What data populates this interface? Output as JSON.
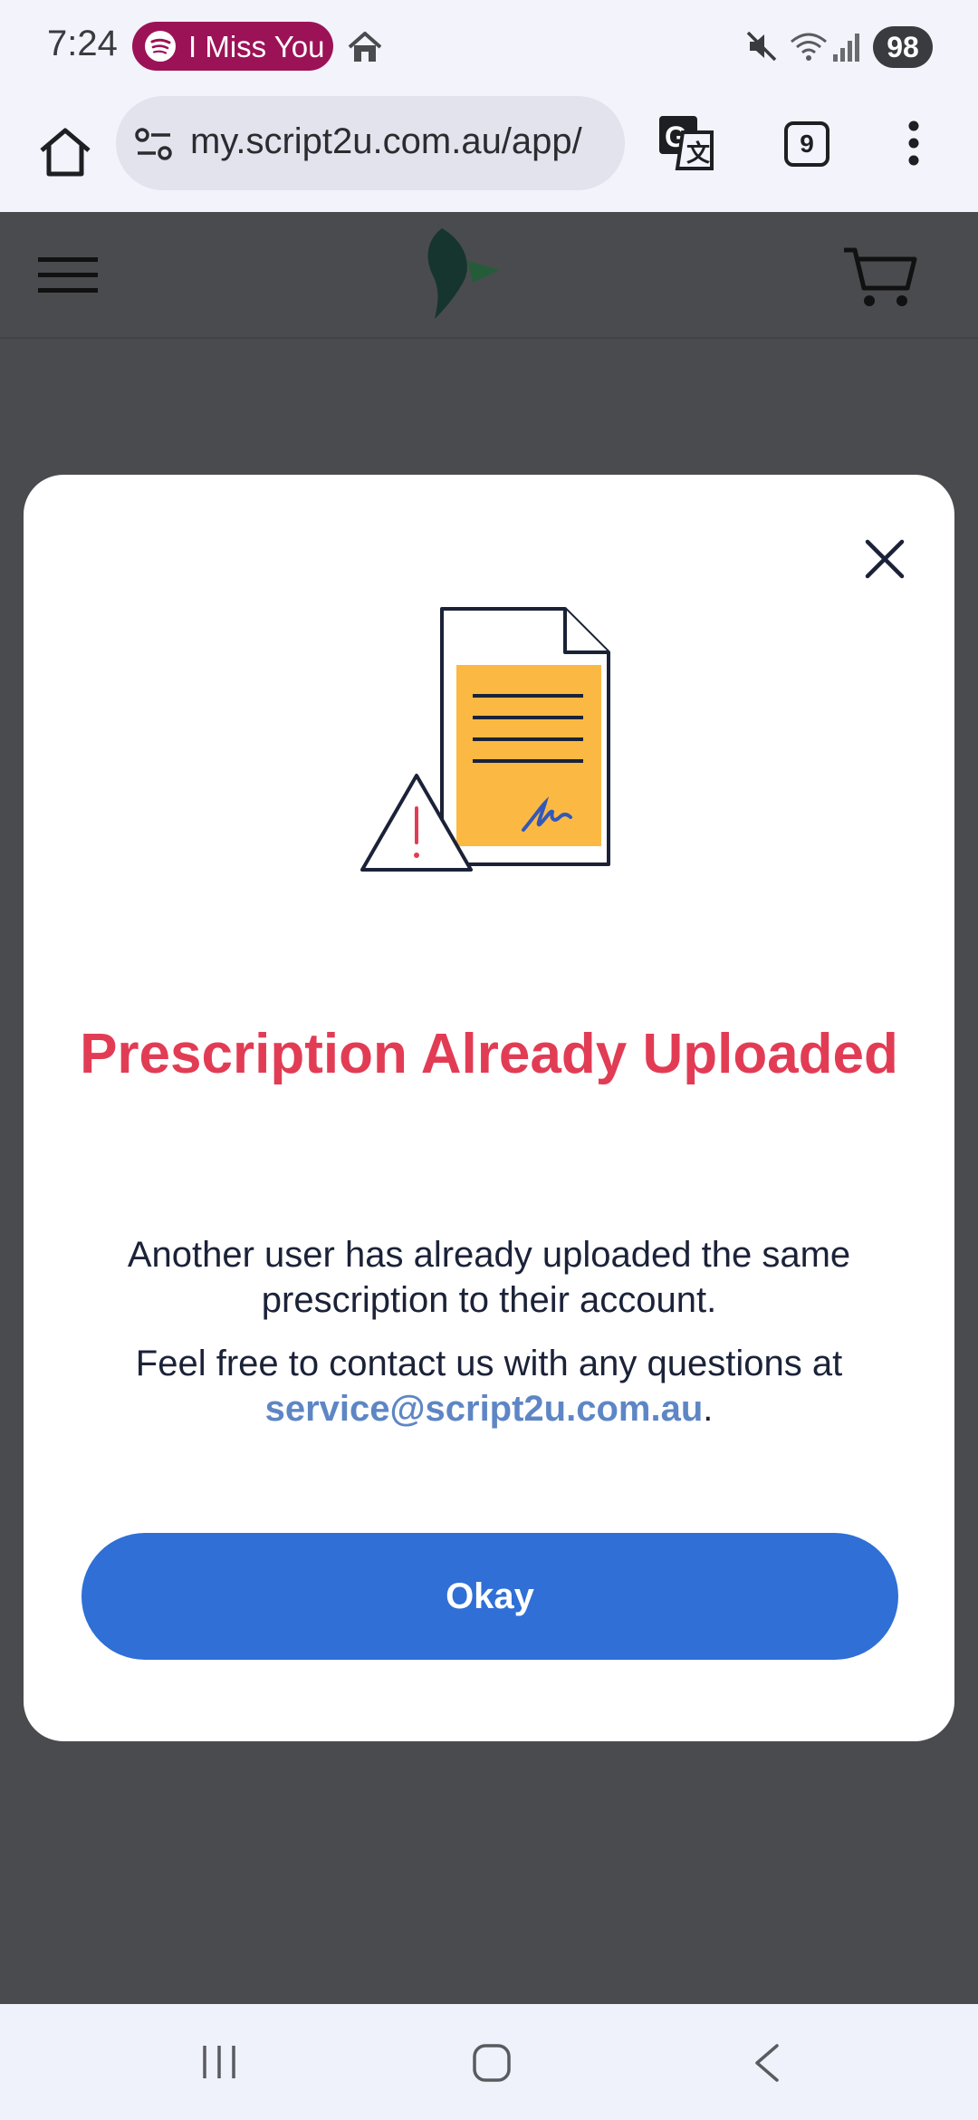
{
  "status_bar": {
    "time": "7:24",
    "media_title": "I Miss You",
    "battery": "98",
    "icons": [
      "spotify-icon",
      "home-icon",
      "mute-icon",
      "wifi-icon",
      "signal-icon"
    ]
  },
  "browser": {
    "url": "my.script2u.com.au/app/",
    "tab_count": "9",
    "icons": [
      "home-icon",
      "site-info-icon",
      "translate-icon",
      "menu-icon"
    ]
  },
  "app_header": {
    "icons": [
      "hamburger-icon",
      "logo-icon",
      "cart-icon"
    ]
  },
  "modal": {
    "title": "Prescription Already Uploaded",
    "message": "Another user has already uploaded the same prescription to their account.",
    "contact_prefix": "Feel free to contact us with any questions at",
    "contact_email": "service@script2u.com.au",
    "contact_suffix": ".",
    "button_label": "Okay",
    "icons": [
      "close-icon",
      "document-warning-icon"
    ]
  },
  "nav_bar": {
    "icons": [
      "recents-icon",
      "home-icon",
      "back-icon"
    ]
  },
  "colors": {
    "title_red": "#e23c55",
    "button_blue": "#2f6fd6",
    "link_blue": "#5e86c5",
    "overlay": "#4a4b4e",
    "spotify_pill": "#9c1256"
  }
}
